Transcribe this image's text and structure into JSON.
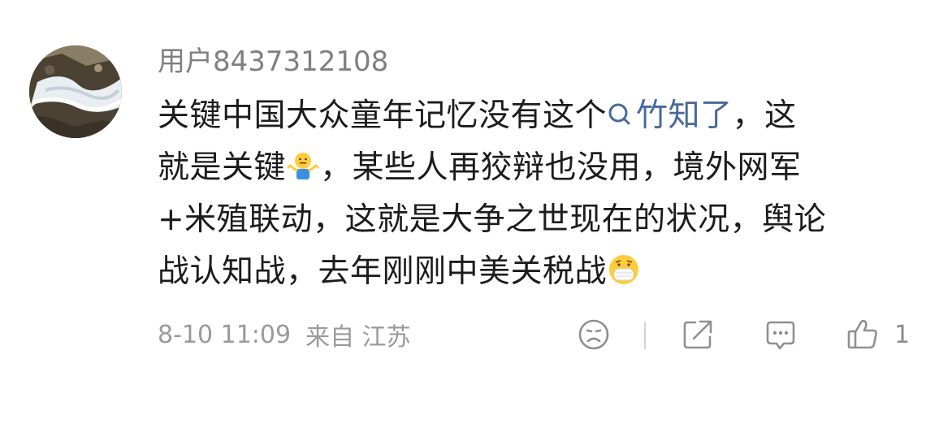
{
  "comment": {
    "username": "用户8437312108",
    "line1_before": "关键中国大众童年记忆没有这个",
    "topic": "竹知了",
    "line1_after": "，这",
    "line2_before": "就是关键",
    "line2_after": "，某些人再狡辩也没用，境外网军",
    "line3": "+米殖联动，这就是大争之世现在的状况，舆论",
    "line4": "战认知战，去年刚刚中美关税战",
    "emoji_shrug": "shrug-emoji",
    "emoji_mask": "mask-emoji"
  },
  "meta": {
    "date": "8-10 11:09",
    "location": "来自 江苏"
  },
  "actions": {
    "dislike_icon": "sad-face-icon",
    "share_icon": "share-icon",
    "reply_icon": "comment-icon",
    "like_icon": "thumbs-up-icon",
    "like_count": "1"
  },
  "colors": {
    "topic": "#47699b",
    "text": "#1c1c1c",
    "meta": "#9a9a9a"
  }
}
